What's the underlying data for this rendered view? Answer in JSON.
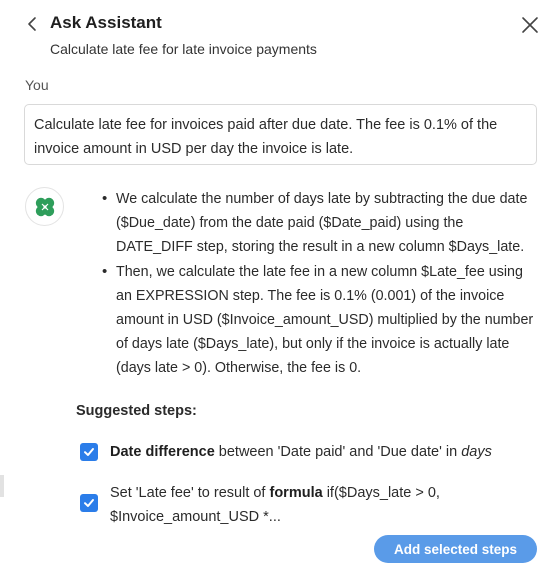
{
  "header": {
    "title": "Ask Assistant",
    "subtitle": "Calculate late fee for late invoice payments"
  },
  "conversation": {
    "user_label": "You",
    "user_message": "Calculate late fee for invoices paid after due date. The fee is 0.1% of the invoice amount in USD per day the invoice is late."
  },
  "assistant": {
    "icon": "clover-icon",
    "icon_color": "#2e9e5b",
    "bullets": [
      "We calculate the number of days late by subtracting the due date ($Due_date) from the date paid ($Date_paid) using the DATE_DIFF step, storing the result in a new column $Days_late.",
      "Then, we calculate the late fee in a new column $Late_fee using an EXPRESSION step. The fee is 0.1% (0.001) of the invoice amount in USD ($Invoice_amount_USD) multiplied by the number of days late ($Days_late), but only if the invoice is actually late (days late > 0). Otherwise, the fee is 0."
    ]
  },
  "suggested": {
    "title": "Suggested steps:",
    "steps": [
      {
        "checked": true,
        "bold_lead": "Date difference",
        "text": " between 'Date paid' and 'Due date' in ",
        "italic_tail": "days"
      },
      {
        "checked": true,
        "prefix": "Set 'Late fee' to result of ",
        "bold": "formula",
        "text_line1": " if($Days_late > 0,",
        "text_line2": "$Invoice_amount_USD *..."
      }
    ]
  },
  "actions": {
    "add_selected_label": "Add selected steps"
  },
  "colors": {
    "accent": "#2b7de9",
    "button": "#5a9be8",
    "border": "#d9d9d9"
  }
}
